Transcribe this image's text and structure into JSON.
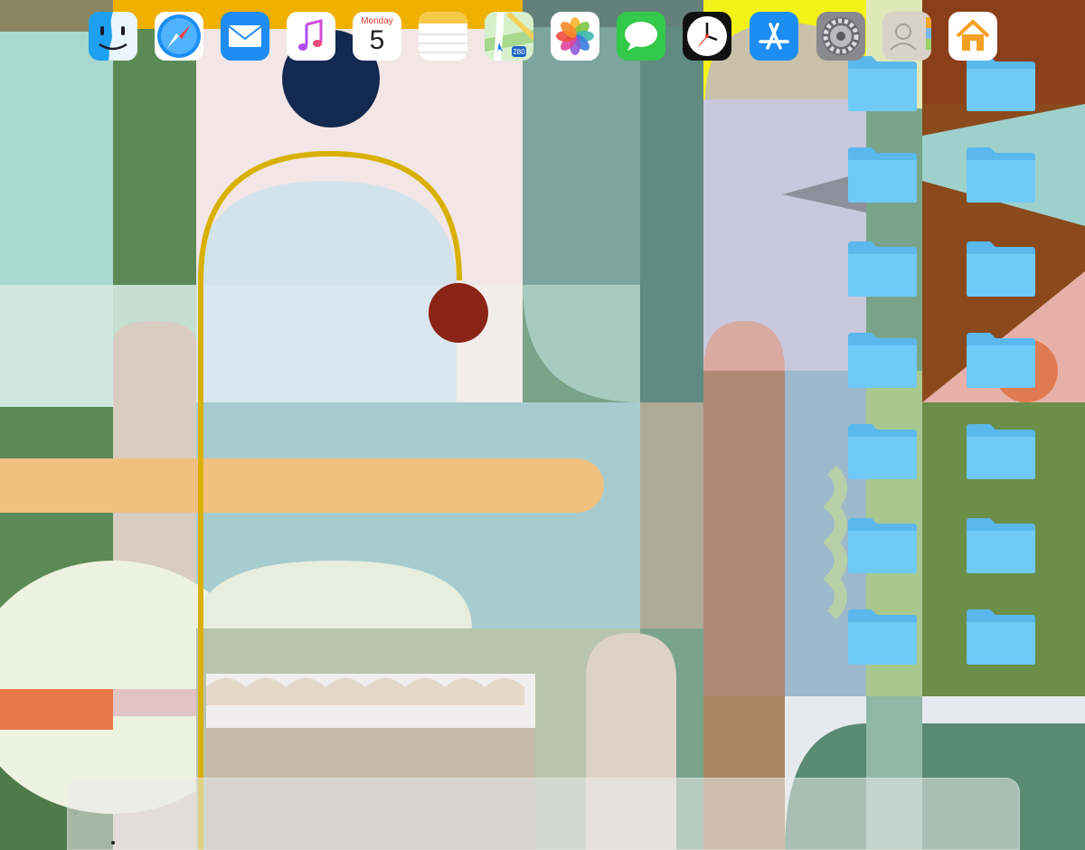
{
  "desktop": {
    "wallpaper": "abstract-geometric-painting",
    "folders": [
      {
        "icon": "folder-icon"
      },
      {
        "icon": "folder-icon"
      },
      {
        "icon": "folder-icon"
      },
      {
        "icon": "folder-icon"
      },
      {
        "icon": "folder-icon"
      },
      {
        "icon": "folder-icon"
      },
      {
        "icon": "folder-icon"
      },
      {
        "icon": "folder-icon"
      },
      {
        "icon": "folder-icon"
      },
      {
        "icon": "folder-icon"
      },
      {
        "icon": "folder-icon"
      },
      {
        "icon": "folder-icon"
      },
      {
        "icon": "folder-icon"
      },
      {
        "icon": "folder-icon"
      }
    ],
    "folder_color": "#6bc8f5"
  },
  "dock": {
    "apps": [
      {
        "name": "finder",
        "icon": "finder-icon",
        "running": true
      },
      {
        "name": "safari",
        "icon": "safari-icon"
      },
      {
        "name": "mail",
        "icon": "mail-icon"
      },
      {
        "name": "music",
        "icon": "music-icon"
      },
      {
        "name": "calendar",
        "icon": "calendar-icon",
        "weekday": "Monday",
        "day": "5"
      },
      {
        "name": "notes",
        "icon": "notes-icon"
      },
      {
        "name": "maps",
        "icon": "maps-icon",
        "route": "280"
      },
      {
        "name": "photos",
        "icon": "photos-icon"
      },
      {
        "name": "messages",
        "icon": "messages-icon"
      },
      {
        "name": "clock",
        "icon": "clock-icon"
      },
      {
        "name": "app-store",
        "icon": "app-store-icon"
      },
      {
        "name": "system-preferences",
        "icon": "gear-icon"
      },
      {
        "name": "contacts",
        "icon": "contacts-icon"
      },
      {
        "name": "home",
        "icon": "home-icon"
      }
    ]
  }
}
